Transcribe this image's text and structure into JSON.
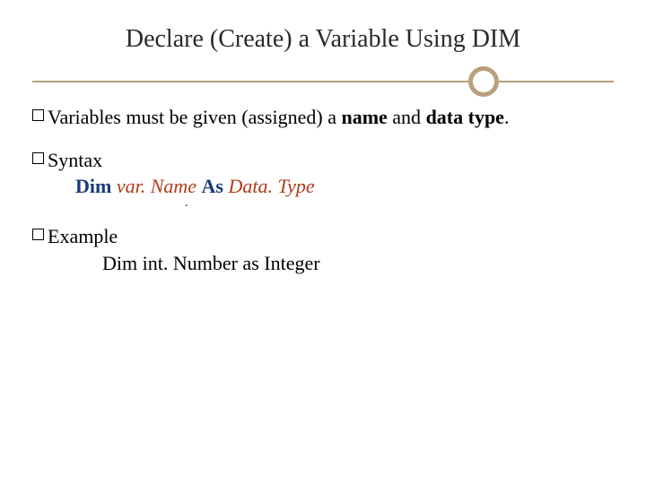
{
  "title": "Declare (Create) a Variable Using DIM",
  "para1": {
    "prefix": "Variables must be given (assigned) a ",
    "bold1": "name",
    "mid": " and ",
    "bold2": "data type",
    "suffix": "."
  },
  "syntax": {
    "label": "Syntax",
    "kw1": "Dim",
    "var": " var. Name ",
    "kw2": "As",
    "type": " Data. Type"
  },
  "dot": ".",
  "example": {
    "label": "Example",
    "code": "Dim int. Number as Integer"
  }
}
